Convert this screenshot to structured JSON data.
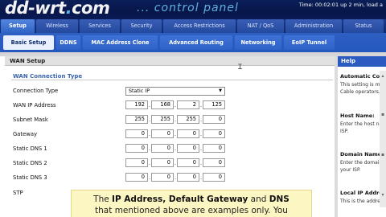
{
  "header": {
    "logo_main": "dd-wrt",
    "logo_dot": ".",
    "logo_tld": "com",
    "tagline": "... control panel",
    "status": "Time: 00:02:01 up 2 min, load a"
  },
  "main_tabs": [
    {
      "label": "Setup",
      "active": true
    },
    {
      "label": "Wireless",
      "active": false
    },
    {
      "label": "Services",
      "active": false
    },
    {
      "label": "Security",
      "active": false
    },
    {
      "label": "Access Restrictions",
      "active": false
    },
    {
      "label": "NAT / QoS",
      "active": false
    },
    {
      "label": "Administration",
      "active": false
    },
    {
      "label": "Status",
      "active": false
    }
  ],
  "sub_tabs": [
    {
      "label": "Basic Setup",
      "active": true
    },
    {
      "label": "DDNS",
      "active": false
    },
    {
      "label": "MAC Address Clone",
      "active": false
    },
    {
      "label": "Advanced Routing",
      "active": false
    },
    {
      "label": "Networking",
      "active": false
    },
    {
      "label": "EoIP Tunnel",
      "active": false
    }
  ],
  "section": {
    "title": "WAN Setup",
    "subtitle": "WAN Connection Type"
  },
  "form": {
    "connection_type_label": "Connection Type",
    "connection_type_value": "Static IP",
    "rows": [
      {
        "label": "WAN IP Address",
        "octets": [
          "192",
          "168",
          "2",
          "125"
        ]
      },
      {
        "label": "Subnet Mask",
        "octets": [
          "255",
          "255",
          "255",
          "0"
        ]
      },
      {
        "label": "Gateway",
        "octets": [
          "0",
          "0",
          "0",
          "0"
        ]
      },
      {
        "label": "Static DNS 1",
        "octets": [
          "0",
          "0",
          "0",
          "0"
        ]
      },
      {
        "label": "Static DNS 2",
        "octets": [
          "0",
          "0",
          "0",
          "0"
        ]
      },
      {
        "label": "Static DNS 3",
        "octets": [
          "0",
          "0",
          "0",
          "0"
        ]
      }
    ],
    "stp_label": "STP"
  },
  "help": {
    "title": "Help",
    "sections": [
      {
        "heading": "Automatic Con",
        "lines": [
          "This setting is mos",
          "Cable operators."
        ]
      },
      {
        "heading": "Host Name:",
        "lines": [
          "Enter the host nam",
          "ISP."
        ]
      },
      {
        "heading": "Domain Name:",
        "lines": [
          "Enter the domain n",
          "your ISP."
        ]
      },
      {
        "heading": "Local IP Addre",
        "lines": [
          "This is the address"
        ]
      }
    ]
  },
  "caption": {
    "line1_pre": "The ",
    "line1_b1": "IP Address, Default Gateway",
    "line1_mid": " and ",
    "line1_b2": "DNS",
    "line2": "that mentioned above are examples only. You"
  },
  "icons": {
    "select_arrow": "chevron-down-icon",
    "cursor": "text-cursor-icon"
  },
  "colors": {
    "header_bg": "#07164a",
    "tab_active": "#2f64c5",
    "subtab_bar": "#2558bd",
    "accent_title": "#3a63b0",
    "caption_bg": "#fcf6c0"
  }
}
